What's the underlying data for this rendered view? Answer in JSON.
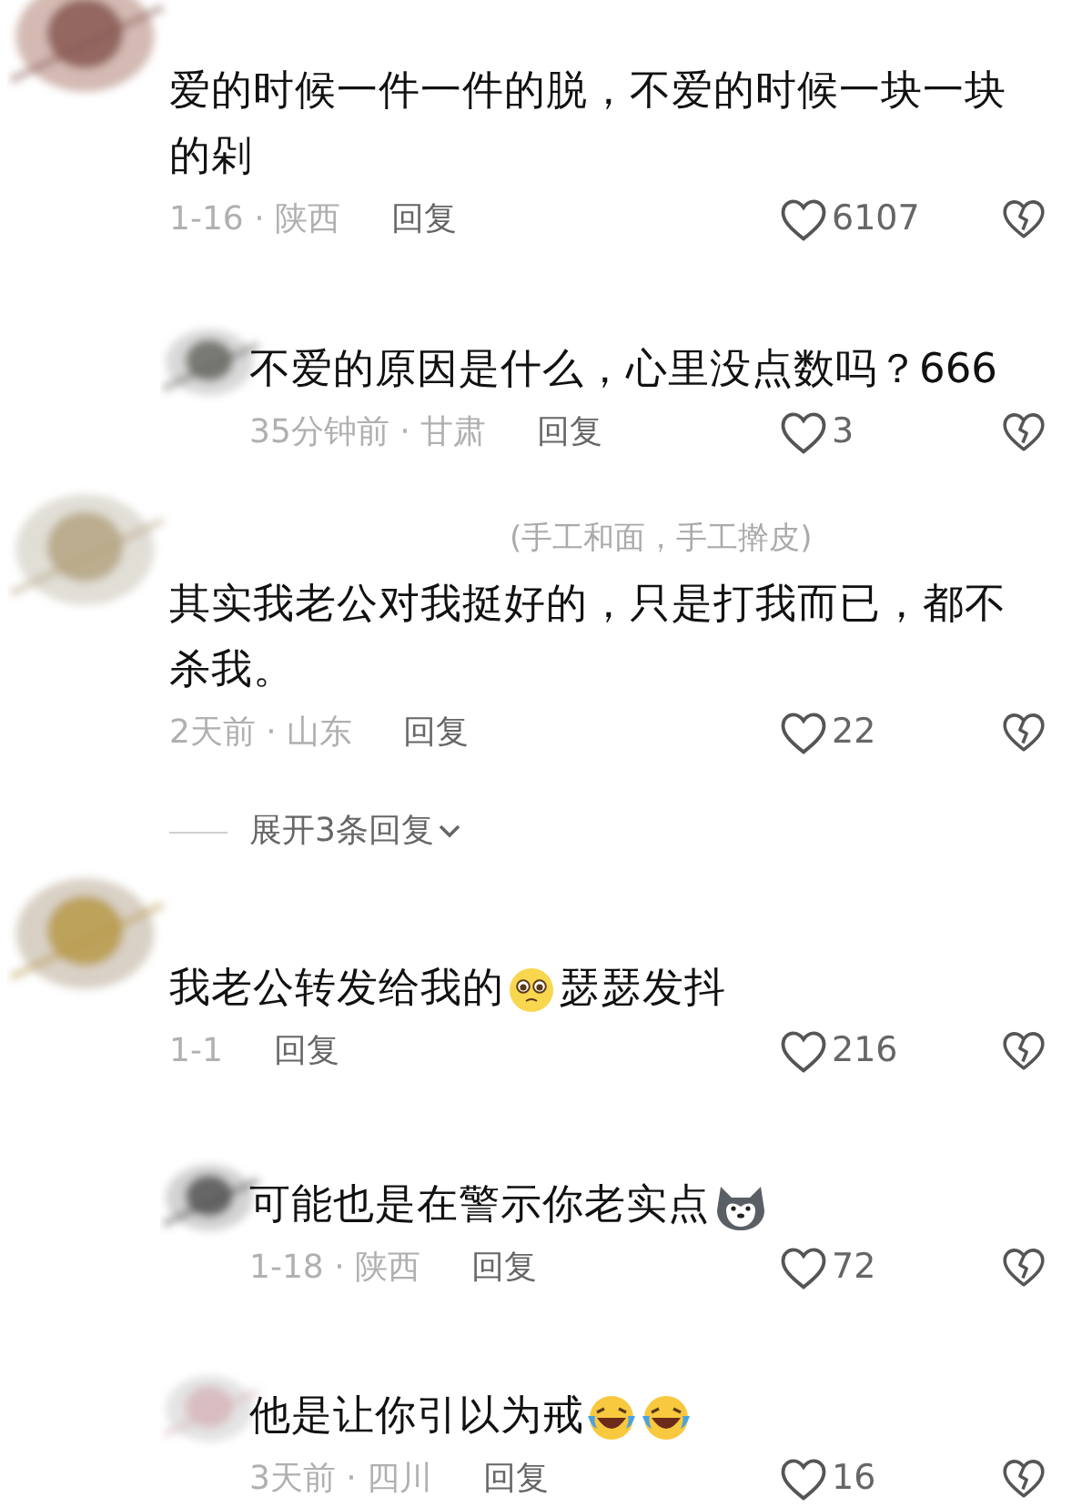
{
  "items": [
    {
      "kind": "comment",
      "body": [
        {
          "kind": "text",
          "text": "爱的时候一件一件的脱，不爱的时候一块一块的剁"
        }
      ],
      "meta": "1-16 · 陕西",
      "reply": "回复",
      "likes": "6107"
    },
    {
      "kind": "reply",
      "body": [
        {
          "kind": "text",
          "text": "不爱的原因是什么，心里没点数吗？666"
        }
      ],
      "meta": "35分钟前 · 甘肃",
      "reply": "回复",
      "likes": "3"
    },
    {
      "kind": "comment",
      "username": "(手工和面，手工擀皮)",
      "body": [
        {
          "kind": "text",
          "text": "其实我老公对我挺好的，只是打我而已，都不杀我。"
        }
      ],
      "meta": "2天前 · 山东",
      "reply": "回复",
      "likes": "22"
    },
    {
      "kind": "expand",
      "label": "展开3条回复"
    },
    {
      "kind": "comment",
      "body": [
        {
          "kind": "text",
          "text": "我老公转发给我的"
        },
        {
          "kind": "pleading"
        },
        {
          "kind": "text",
          "text": "瑟瑟发抖"
        }
      ],
      "meta": "1-1",
      "reply": "回复",
      "likes": "216"
    },
    {
      "kind": "reply",
      "body": [
        {
          "kind": "text",
          "text": "可能也是在警示你老实点"
        },
        {
          "kind": "husky"
        }
      ],
      "meta": "1-18 · 陕西",
      "reply": "回复",
      "likes": "72"
    },
    {
      "kind": "reply",
      "body": [
        {
          "kind": "text",
          "text": "他是让你引以为戒"
        },
        {
          "kind": "laughing"
        },
        {
          "kind": "laughing"
        }
      ],
      "meta": "3天前 · 四川",
      "reply": "回复",
      "likes": "16"
    }
  ]
}
